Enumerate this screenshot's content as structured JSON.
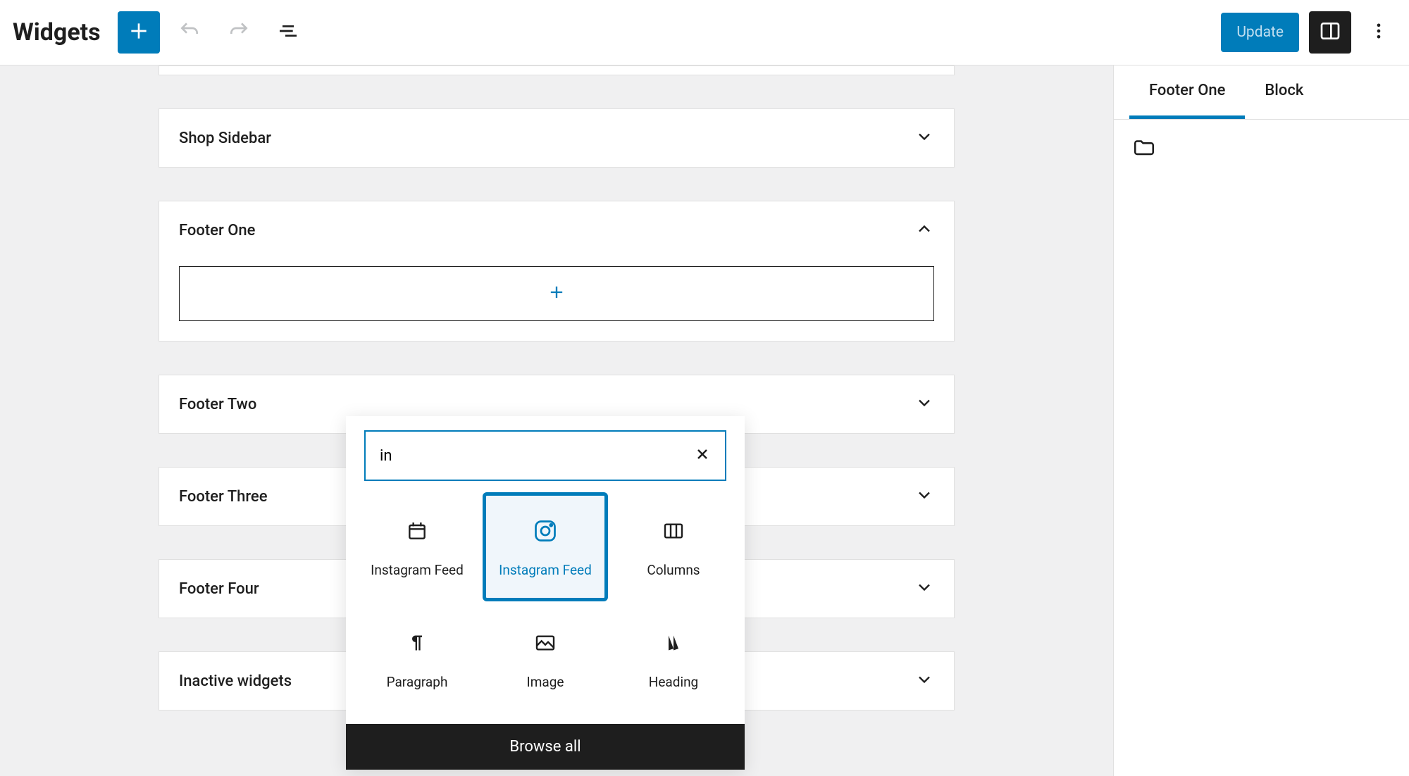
{
  "header": {
    "title": "Widgets",
    "update_label": "Update"
  },
  "areas": {
    "shop_sidebar": "Shop Sidebar",
    "footer_one": "Footer One",
    "footer_two": "Footer Two",
    "footer_three": "Footer Three",
    "footer_four": "Footer Four",
    "inactive": "Inactive widgets"
  },
  "inserter": {
    "search_value": "in",
    "blocks": {
      "instagram_feed_1": "Instagram Feed",
      "instagram_feed_2": "Instagram Feed",
      "columns": "Columns",
      "paragraph": "Paragraph",
      "image": "Image",
      "heading": "Heading"
    },
    "browse_all": "Browse all"
  },
  "sidebar": {
    "tab_area": "Footer One",
    "tab_block": "Block"
  }
}
